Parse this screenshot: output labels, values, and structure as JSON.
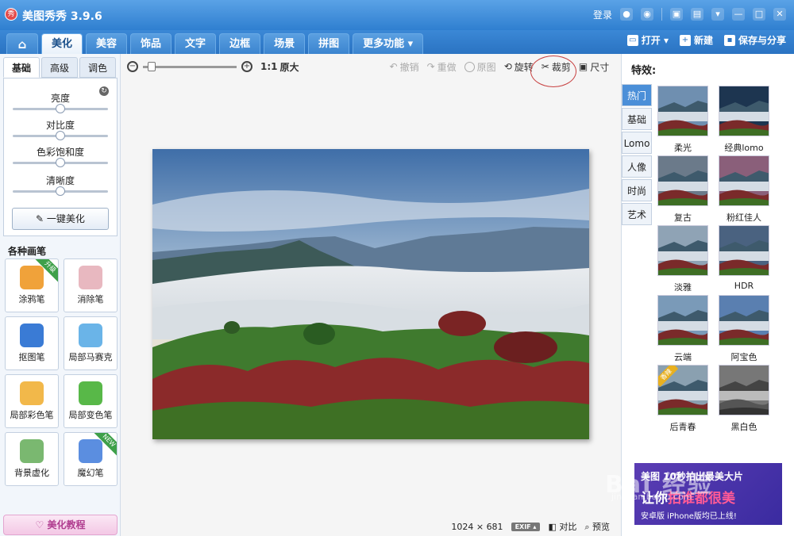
{
  "window": {
    "title": "美图秀秀 3.9.6",
    "logo_char": "秀",
    "login": "登录"
  },
  "nav": {
    "tabs": [
      "美化",
      "美容",
      "饰品",
      "文字",
      "边框",
      "场景",
      "拼图",
      "更多功能 ▾"
    ],
    "open": "打开 ▾",
    "new": "新建",
    "save_share": "保存与分享"
  },
  "left": {
    "subtabs": [
      "基础",
      "高级",
      "调色"
    ],
    "adjust": [
      {
        "label": "亮度",
        "value": 0.5
      },
      {
        "label": "对比度",
        "value": 0.5
      },
      {
        "label": "色彩饱和度",
        "value": 0.5
      },
      {
        "label": "清晰度",
        "value": 0.5
      }
    ],
    "one_click": "一键美化",
    "brush_title": "各种画笔",
    "brushes": [
      {
        "label": "涂鸦笔",
        "badge": "升级",
        "badge_color": "#3ea04a",
        "icon_color": "#f0a23a"
      },
      {
        "label": "消除笔",
        "badge": "",
        "icon_color": "#e8b8c0"
      },
      {
        "label": "抠图笔",
        "badge": "",
        "icon_color": "#3a7bd5"
      },
      {
        "label": "局部马赛克",
        "badge": "",
        "icon_color": "#6ab4e8"
      },
      {
        "label": "局部彩色笔",
        "badge": "",
        "icon_color": "#f2b84a"
      },
      {
        "label": "局部变色笔",
        "badge": "",
        "icon_color": "#58b848"
      },
      {
        "label": "背景虚化",
        "badge": "",
        "icon_color": "#7ab870"
      },
      {
        "label": "魔幻笔",
        "badge": "NEW",
        "badge_color": "#3ea04a",
        "icon_color": "#5b8ee0"
      }
    ],
    "tutorial": "美化教程"
  },
  "toolbar": {
    "zoom_level": 0.05,
    "one_to_one": "1:1",
    "original_size": "原大",
    "undo": "撤销",
    "redo": "重做",
    "original": "原图",
    "rotate": "旋转",
    "crop": "裁剪",
    "size": "尺寸"
  },
  "status": {
    "dimensions": "1024 × 681",
    "exif": "EXIF ▴",
    "compare": "对比",
    "preview": "预览"
  },
  "right": {
    "title": "特效:",
    "categories": [
      "热门",
      "基础",
      "Lomo",
      "人像",
      "时尚",
      "艺术"
    ],
    "effects": [
      {
        "label": "柔光",
        "badge": ""
      },
      {
        "label": "经典lomo",
        "badge": ""
      },
      {
        "label": "复古",
        "badge": ""
      },
      {
        "label": "粉红佳人",
        "badge": ""
      },
      {
        "label": "淡雅",
        "badge": ""
      },
      {
        "label": "HDR",
        "badge": ""
      },
      {
        "label": "云端",
        "badge": ""
      },
      {
        "label": "阿宝色",
        "badge": ""
      },
      {
        "label": "后青春",
        "badge": "香辣"
      },
      {
        "label": "黑白色",
        "badge": ""
      }
    ],
    "ad": {
      "top": "美图 10秒拍出最美大片",
      "main_a": "让你",
      "main_b": "拍谁都很美",
      "sub": "安卓版 iPhone版均已上线!"
    }
  },
  "watermark": {
    "main": "Bai 经验",
    "sub": "jingyan.baidu.com"
  },
  "colors": {
    "titlebar": "#2f7fd0",
    "accent": "#4b8fd8",
    "crop_circle": "#c84242"
  }
}
